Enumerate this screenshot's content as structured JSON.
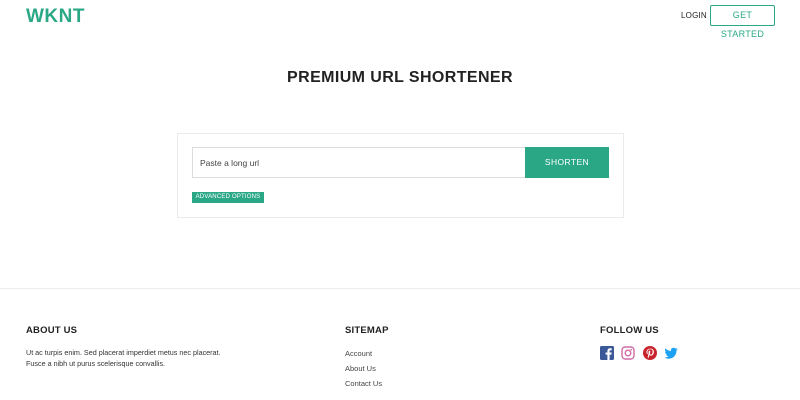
{
  "header": {
    "logo": "WKNT",
    "login_label": "LOGIN",
    "get_started_label": "GET STARTED"
  },
  "hero": {
    "title": "PREMIUM URL SHORTENER"
  },
  "shortener": {
    "url_placeholder": "Paste a long url",
    "shorten_label": "SHORTEN",
    "advanced_label": "ADVANCED OPTIONS"
  },
  "footer": {
    "about": {
      "title": "ABOUT US",
      "line1": "Ut ac turpis enim. Sed placerat imperdiet metus nec placerat.",
      "line2": "Fusce a nibh ut purus scelerisque convallis."
    },
    "sitemap": {
      "title": "SITEMAP",
      "links": [
        "Account",
        "About Us",
        "Contact Us"
      ]
    },
    "follow": {
      "title": "FOLLOW US",
      "icons": [
        "facebook-icon",
        "instagram-icon",
        "pinterest-icon",
        "twitter-icon"
      ]
    }
  },
  "colors": {
    "accent": "#2aa885",
    "facebook": "#3b5998",
    "instagram": "#c13584",
    "pinterest": "#c8232c",
    "twitter": "#1da1f2"
  }
}
